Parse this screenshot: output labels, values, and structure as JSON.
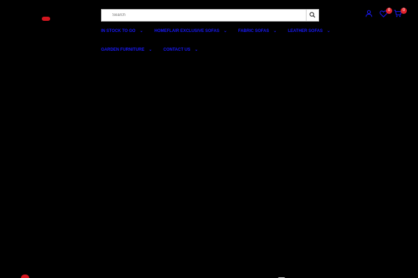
{
  "colors": {
    "background": "#000000",
    "nav_link": "#1a1aff",
    "brand_red": "#d3161f",
    "badge": "#e2232b"
  },
  "search": {
    "placeholder": "Search",
    "button_icon": "search-icon"
  },
  "nav": {
    "rows": [
      [
        {
          "label": "In Stock To Go",
          "chevron": "⌄"
        },
        {
          "label": "Homeflair Exclusive Sofas",
          "chevron": "⌄"
        },
        {
          "label": "Fabric Sofas",
          "chevron": "⌄"
        },
        {
          "label": "Leather Sofas",
          "chevron": "⌄"
        }
      ],
      [
        {
          "label": "Garden Furniture",
          "chevron": "⌄"
        },
        {
          "label": "Contact Us",
          "chevron": "⌄"
        }
      ]
    ]
  },
  "header_icons": {
    "account": {
      "icon": "user-icon"
    },
    "wishlist": {
      "icon": "heart-icon",
      "count": "0"
    },
    "cart": {
      "icon": "cart-icon",
      "count": "0"
    }
  },
  "bottom_bar": {
    "icons": [
      "brand-icon",
      "card-icon",
      "document-icon"
    ]
  }
}
